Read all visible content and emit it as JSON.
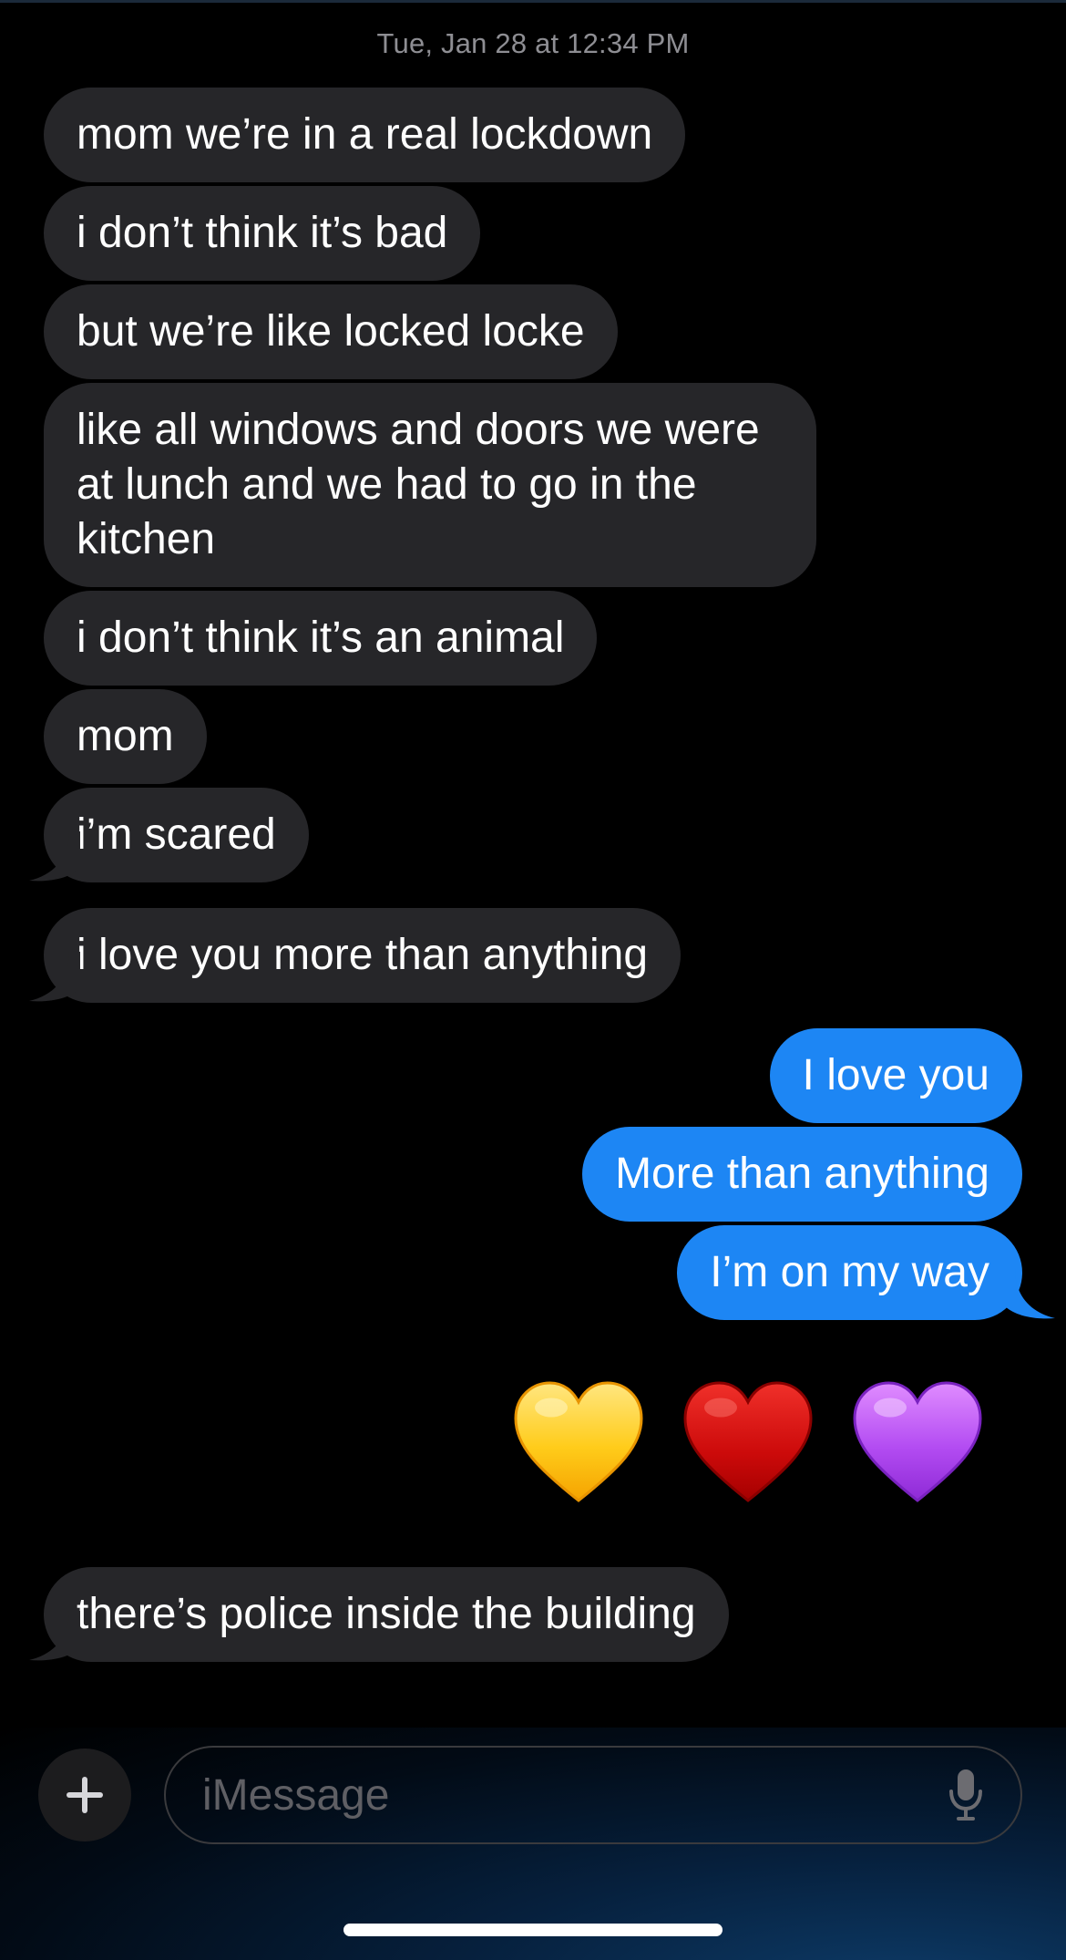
{
  "header": {
    "timestamp": "Tue, Jan 28 at 12:34 PM"
  },
  "colors": {
    "background": "#000000",
    "received_bubble": "#262629",
    "sent_bubble": "#1d86f4",
    "timestamp_text": "#8e8e93",
    "placeholder_text": "#5f5f64"
  },
  "messages": [
    {
      "sender": "them",
      "text": "mom we’re in a real lockdown"
    },
    {
      "sender": "them",
      "text": "i don’t think it’s bad"
    },
    {
      "sender": "them",
      "text": "but we’re like locked locke"
    },
    {
      "sender": "them",
      "text": "like all windows and doors we were at lunch and we had to go in the kitchen"
    },
    {
      "sender": "them",
      "text": "i don’t think it’s an animal"
    },
    {
      "sender": "them",
      "text": "mom"
    },
    {
      "sender": "them",
      "text": "i’m scared"
    },
    {
      "sender": "them",
      "text": "i love you more than anything"
    },
    {
      "sender": "me",
      "text": "I love you"
    },
    {
      "sender": "me",
      "text": "More than anything"
    },
    {
      "sender": "me",
      "text": "I’m on my way"
    },
    {
      "sender": "me",
      "type": "emoji",
      "icons": [
        "yellow-heart",
        "red-heart",
        "purple-heart"
      ]
    },
    {
      "sender": "them",
      "text": "there’s police inside the building"
    }
  ],
  "composer": {
    "placeholder": "iMessage",
    "plus_icon": "plus-icon",
    "mic_icon": "microphone-icon"
  }
}
